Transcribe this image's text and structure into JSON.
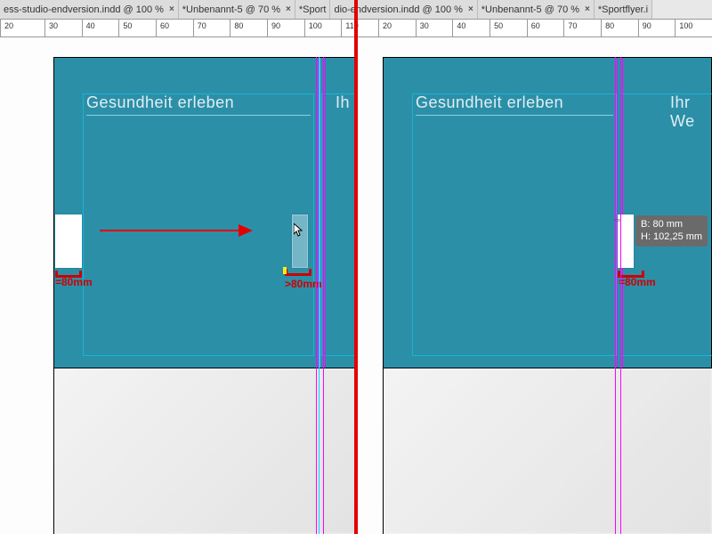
{
  "tabs": [
    {
      "label": "ess-studio-endversion.indd @ 100 %"
    },
    {
      "label": "*Unbenannt-5 @ 70 %"
    },
    {
      "label": "*Sport"
    },
    {
      "label": "dio-endversion.indd @ 100 %"
    },
    {
      "label": "*Unbenannt-5 @ 70 %"
    },
    {
      "label": "*Sportflyer.i"
    }
  ],
  "ruler_left": [
    "20",
    "30",
    "40",
    "50",
    "60",
    "70",
    "80",
    "90",
    "100",
    "110"
  ],
  "ruler_right": [
    "20",
    "30",
    "40",
    "50",
    "60",
    "70",
    "80",
    "90",
    "100"
  ],
  "heading1": "Gesundheit erleben",
  "heading2": "Ih",
  "heading3": "Gesundheit erleben",
  "heading4": "Ihr We",
  "dim": {
    "left_eq": "=80mm",
    "gt": ">80mm",
    "right_eq": "=80mm"
  },
  "tooltip": {
    "line1": "B: 80 mm",
    "line2": "H: 102,25 mm"
  }
}
